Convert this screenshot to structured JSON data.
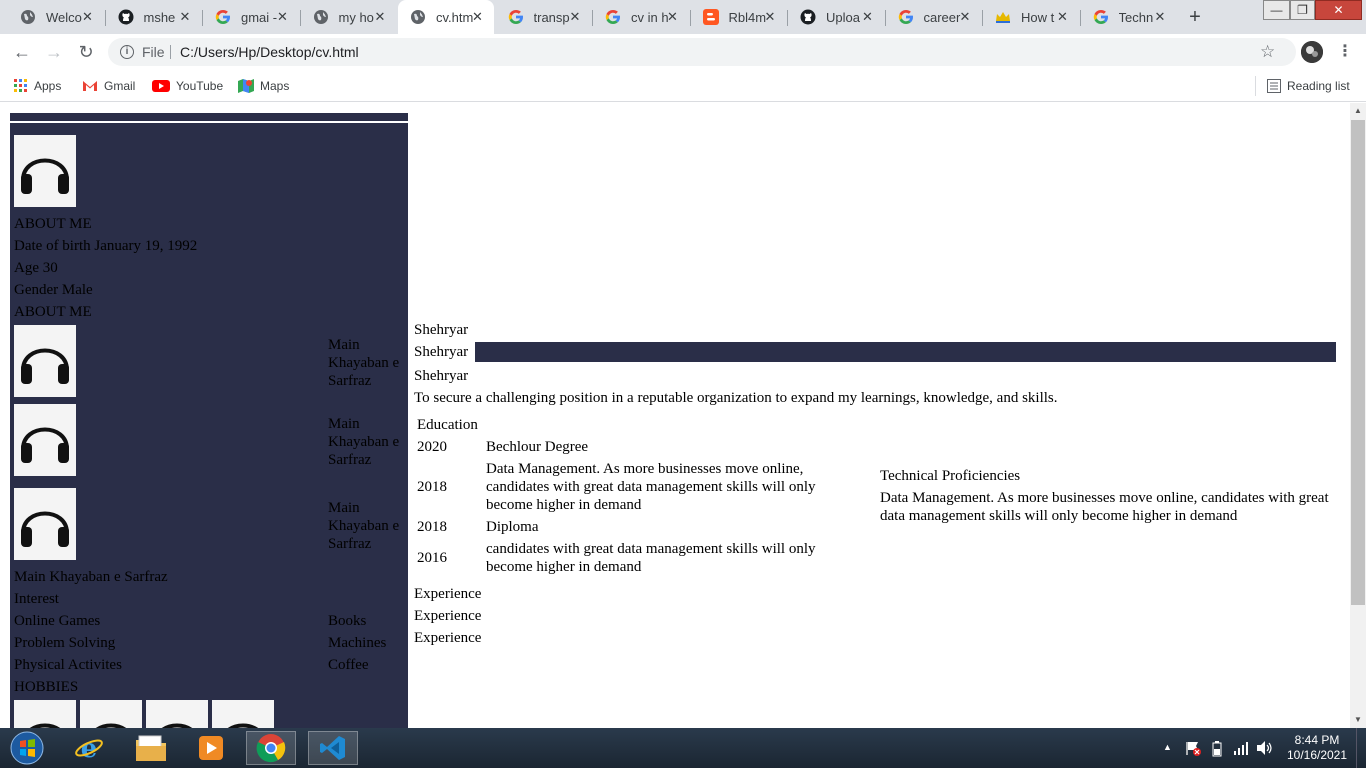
{
  "browser": {
    "tabs": [
      {
        "title": "Welco",
        "icon": "globe-icon"
      },
      {
        "title": "mshe",
        "icon": "github-icon"
      },
      {
        "title": "gmai -",
        "icon": "google-icon"
      },
      {
        "title": "my ho",
        "icon": "globe-icon"
      },
      {
        "title": "cv.htm",
        "icon": "globe-icon"
      },
      {
        "title": "transp",
        "icon": "google-icon"
      },
      {
        "title": "cv in h",
        "icon": "google-icon"
      },
      {
        "title": "Rbl4m",
        "icon": "blogger-icon"
      },
      {
        "title": "Uploa",
        "icon": "github-icon"
      },
      {
        "title": "career",
        "icon": "google-icon"
      },
      {
        "title": "How t",
        "icon": "crown-icon"
      },
      {
        "title": "Techn",
        "icon": "google-icon"
      }
    ],
    "active_tab_index": 4,
    "address_scheme_label": "File",
    "address_url": "C:/Users/Hp/Desktop/cv.html",
    "bookmarks": [
      {
        "label": "Apps",
        "icon": "apps-grid-icon"
      },
      {
        "label": "Gmail",
        "icon": "gmail-icon"
      },
      {
        "label": "YouTube",
        "icon": "youtube-icon"
      },
      {
        "label": "Maps",
        "icon": "maps-icon"
      }
    ],
    "reading_list_label": "Reading list"
  },
  "cv": {
    "sidebar": {
      "about_heading": "ABOUT ME",
      "dob": "Date of birth January 19, 1992",
      "age": "Age 30",
      "gender": "Gender Male",
      "about_heading_2": "ABOUT ME",
      "contact_entries": [
        {
          "text": "Main Khayaban e Sarfraz"
        },
        {
          "text": "Main Khayaban e Sarfraz"
        },
        {
          "text": "Main Khayaban e Sarfraz"
        }
      ],
      "address_line": "Main Khayaban e Sarfraz",
      "interest_heading": "Interest",
      "interests": [
        {
          "left": "Online Games",
          "right": "Books"
        },
        {
          "left": "Problem Solving",
          "right": "Machines"
        },
        {
          "left": "Physical Activites",
          "right": "Coffee"
        }
      ],
      "hobbies_heading": "HOBBIES"
    },
    "main": {
      "name_line_1": "Shehryar",
      "name_line_2": "Shehryar",
      "name_line_3": "Shehryar",
      "objective": "To secure a challenging position in a reputable organization to expand my learnings, knowledge, and skills.",
      "education_heading": "Education",
      "education": [
        {
          "year": "2020",
          "desc": "Bechlour Degree"
        },
        {
          "year": "2018",
          "desc": "Data Management. As more businesses move online, candidates with great data management skills will only become higher in demand"
        },
        {
          "year": "2018",
          "desc": "Diploma"
        },
        {
          "year": "2016",
          "desc": "candidates with great data management skills will only become higher in demand"
        }
      ],
      "tech_heading": "Technical Proficiencies",
      "tech_text": "Data Management. As more businesses move online, candidates with great data management skills will only become higher in demand",
      "experience": [
        "Experience",
        "Experience",
        "Experience"
      ]
    },
    "colors": {
      "sidebar_bg": "#2a2e48",
      "accent_bar": "#2a2e48"
    }
  },
  "taskbar": {
    "apps": [
      "windows-start-icon",
      "internet-explorer-icon",
      "file-explorer-icon",
      "media-player-icon",
      "chrome-icon",
      "vscode-icon"
    ],
    "time": "8:44 PM",
    "date": "10/16/2021"
  }
}
